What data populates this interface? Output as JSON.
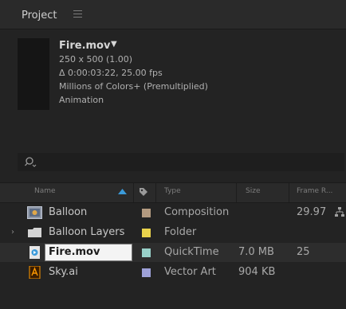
{
  "panel": {
    "title": "Project"
  },
  "asset": {
    "name": "Fire.mov",
    "dropdown": "▼",
    "resolution": "250 x 500 (1.00)",
    "duration": "Δ 0:00:03:22, 25.00 fps",
    "colors": "Millions of Colors+ (Premultiplied)",
    "codec": "Animation"
  },
  "search": {
    "icon": "search-icon",
    "value": ""
  },
  "columns": {
    "name": "Name",
    "type": "Type",
    "size": "Size",
    "frame_rate": "Frame R..."
  },
  "rows": [
    {
      "name": "Balloon",
      "icon": "composition-icon",
      "type": "Composition",
      "size": "",
      "frame_rate": "29.97",
      "label_color": "#b39a80"
    },
    {
      "name": "Balloon Layers",
      "icon": "folder-icon",
      "type": "Folder",
      "size": "",
      "frame_rate": "",
      "label_color": "#e8d24c"
    },
    {
      "name": "Fire.mov",
      "icon": "quicktime-icon",
      "type": "QuickTime",
      "size": "7.0 MB",
      "frame_rate": "25",
      "label_color": "#98d0c8"
    },
    {
      "name": "Sky.ai",
      "icon": "illustrator-icon",
      "type": "Vector Art",
      "size": "904 KB",
      "frame_rate": "",
      "label_color": "#9ea1d8"
    }
  ],
  "colors": {
    "panel_bg": "#232323",
    "header_bg": "#2a2a2a",
    "accent_blue": "#3b9ad9"
  }
}
